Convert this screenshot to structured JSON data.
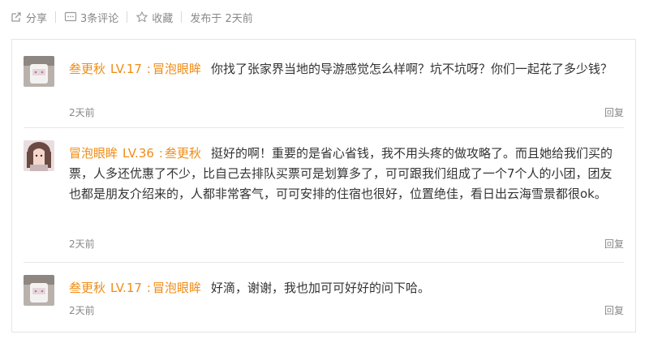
{
  "actions": {
    "share_label": "分享",
    "comments_label": "3条评论",
    "favorite_label": "收藏",
    "published_label": "发布于 2天前"
  },
  "comments": [
    {
      "author": "叁更秋",
      "level": "LV.17",
      "reply_to": "冒泡眼眸",
      "text": "你找了张家界当地的导游感觉怎么样啊？坑不坑呀？你们一起花了多少钱？",
      "time": "2天前",
      "reply_label": "回复"
    },
    {
      "author": "冒泡眼眸",
      "level": "LV.36",
      "reply_to": "叁更秋",
      "text": "挺好的啊！重要的是省心省钱，我不用头疼的做攻略了。而且她给我们买的票，人多还优惠了不少，比自己去排队买票可是划算多了，可可跟我们组成了一个7个人的小团，团友也都是朋友介绍来的，人都非常客气，可可安排的住宿也很好，位置绝佳，看日出云海雪景都很ok。",
      "time": "2天前",
      "reply_label": "回复"
    },
    {
      "author": "叁更秋",
      "level": "LV.17",
      "reply_to": "冒泡眼眸",
      "text": "好滴，谢谢，我也加可可好好的问下哈。",
      "time": "2天前",
      "reply_label": "回复"
    }
  ]
}
